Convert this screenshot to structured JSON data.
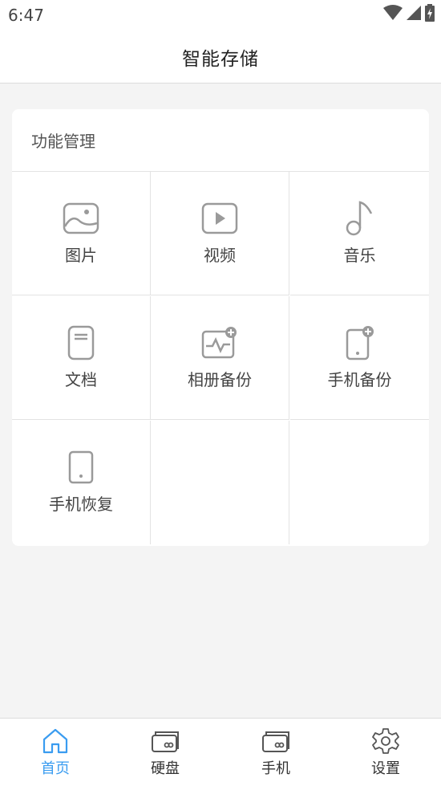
{
  "status_bar": {
    "time": "6:47"
  },
  "header": {
    "title": "智能存储"
  },
  "card": {
    "title": "功能管理",
    "items": [
      {
        "label": "图片",
        "icon": "image-icon"
      },
      {
        "label": "视频",
        "icon": "video-icon"
      },
      {
        "label": "音乐",
        "icon": "music-icon"
      },
      {
        "label": "文档",
        "icon": "document-icon"
      },
      {
        "label": "相册备份",
        "icon": "album-backup-icon"
      },
      {
        "label": "手机备份",
        "icon": "phone-backup-icon"
      },
      {
        "label": "手机恢复",
        "icon": "phone-restore-icon"
      }
    ]
  },
  "tabs": [
    {
      "label": "首页",
      "icon": "home-icon",
      "active": true
    },
    {
      "label": "硬盘",
      "icon": "disk-icon",
      "active": false
    },
    {
      "label": "手机",
      "icon": "phone-disk-icon",
      "active": false
    },
    {
      "label": "设置",
      "icon": "gear-icon",
      "active": false
    }
  ],
  "colors": {
    "accent": "#3a9cf0",
    "icon_gray": "#9a9a9a",
    "divider": "#e3e3e3",
    "background": "#f4f4f4"
  }
}
